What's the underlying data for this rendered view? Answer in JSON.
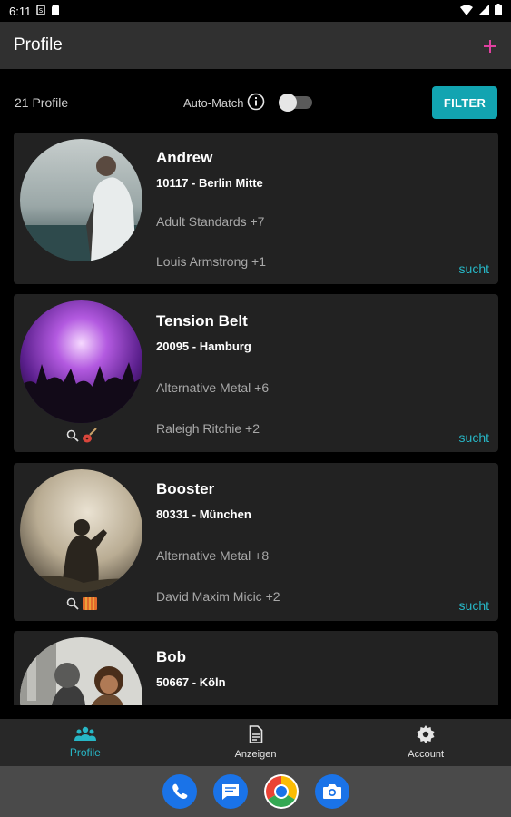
{
  "status_bar": {
    "time": "6:11"
  },
  "app_bar": {
    "title": "Profile",
    "add_icon": "plus-icon",
    "accent_color": "#e040a0"
  },
  "filter_bar": {
    "count_label": "21 Profile",
    "automatch_label": "Auto-Match",
    "filter_label": "FILTER",
    "button_color": "#12a4b1"
  },
  "profiles": [
    {
      "name": "Andrew",
      "location": "10117 - Berlin Mitte",
      "genres": "Adult Standards +7",
      "artists": "Louis Armstrong +1",
      "status": "sucht"
    },
    {
      "name": "Tension Belt",
      "location": "20095 - Hamburg",
      "genres": "Alternative Metal +6",
      "artists": "Raleigh Ritchie +2",
      "status": "sucht",
      "badge_icons": [
        "search-icon",
        "guitar-icon"
      ]
    },
    {
      "name": "Booster",
      "location": "80331 - München",
      "genres": "Alternative Metal +8",
      "artists": "David Maxim Micic +2",
      "status": "sucht",
      "badge_icons": [
        "search-icon",
        "accordion-icon"
      ]
    },
    {
      "name": "Bob",
      "location": "50667 - Köln"
    }
  ],
  "bottom_nav": [
    {
      "label": "Profile",
      "icon": "people-icon",
      "active": true
    },
    {
      "label": "Anzeigen",
      "icon": "document-icon",
      "active": false
    },
    {
      "label": "Account",
      "icon": "gear-icon",
      "active": false
    }
  ],
  "dock": [
    "phone-icon",
    "messages-icon",
    "chrome-icon",
    "camera-icon"
  ]
}
